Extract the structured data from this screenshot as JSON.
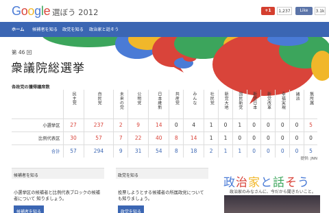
{
  "header": {
    "logo": {
      "g1": "G",
      "o1": "o",
      "o2": "o",
      "g2": "g",
      "l": "l",
      "e": "e"
    },
    "title": "選ぼう 2012",
    "gplus_label": "+1",
    "gplus_count": "1,237",
    "fb_label": "Like",
    "fb_count": "3.1k"
  },
  "nav": {
    "items": [
      "ホーム",
      "候補者を知る",
      "政党を知る",
      "政治家と話そう"
    ]
  },
  "hero": {
    "edition": "第 46 回",
    "heading": "衆議院総選挙"
  },
  "table": {
    "title": "各政党の獲得議席数",
    "parties": [
      "民主党",
      "自民党",
      "未来の党",
      "公明党",
      "日本維新",
      "共産党",
      "みんな",
      "社民党",
      "新党大地",
      "国民新党",
      "新党日本",
      "新党改革",
      "幸福実現",
      "諸派",
      "無所属"
    ],
    "rows": [
      {
        "label": "小選挙区",
        "values": [
          "27",
          "237",
          "2",
          "9",
          "14",
          "0",
          "4",
          "1",
          "0",
          "1",
          "0",
          "0",
          "0",
          "0",
          "5"
        ]
      },
      {
        "label": "比例代表区",
        "values": [
          "30",
          "57",
          "7",
          "22",
          "40",
          "8",
          "14",
          "1",
          "1",
          "0",
          "0",
          "0",
          "0",
          "0",
          "0"
        ]
      },
      {
        "label": "合計",
        "values": [
          "57",
          "294",
          "9",
          "31",
          "54",
          "8",
          "18",
          "2",
          "1",
          "1",
          "0",
          "0",
          "0",
          "0",
          "5"
        ]
      }
    ],
    "source": "提供: JNN"
  },
  "cards": [
    {
      "head": "候補者を知る",
      "body": "小選挙区の候補者と比例代表ブロックの候補者について 知りましょう。",
      "button": "候補者を知る"
    },
    {
      "head": "政党を知る",
      "body": "投票しようとする候補者の所属政党についても知りましょう。",
      "button": "政党を知る"
    }
  ],
  "promo": {
    "chars": [
      "政",
      "治",
      "家",
      "と",
      "話",
      "そ",
      "う"
    ],
    "colors": [
      "#4a7bd6",
      "#d9443a",
      "#f1b72a",
      "#4a7bd6",
      "#3ca55c",
      "#d9443a",
      "#4a7bd6"
    ],
    "subtitle": "政治家のみなさんに、今だから聞きたいこと。"
  },
  "colors": {
    "nav": "#3b66b3",
    "red": "#d9443a",
    "green": "#3ca55c",
    "yellow": "#f1b72a",
    "blue": "#4a7bd6"
  }
}
